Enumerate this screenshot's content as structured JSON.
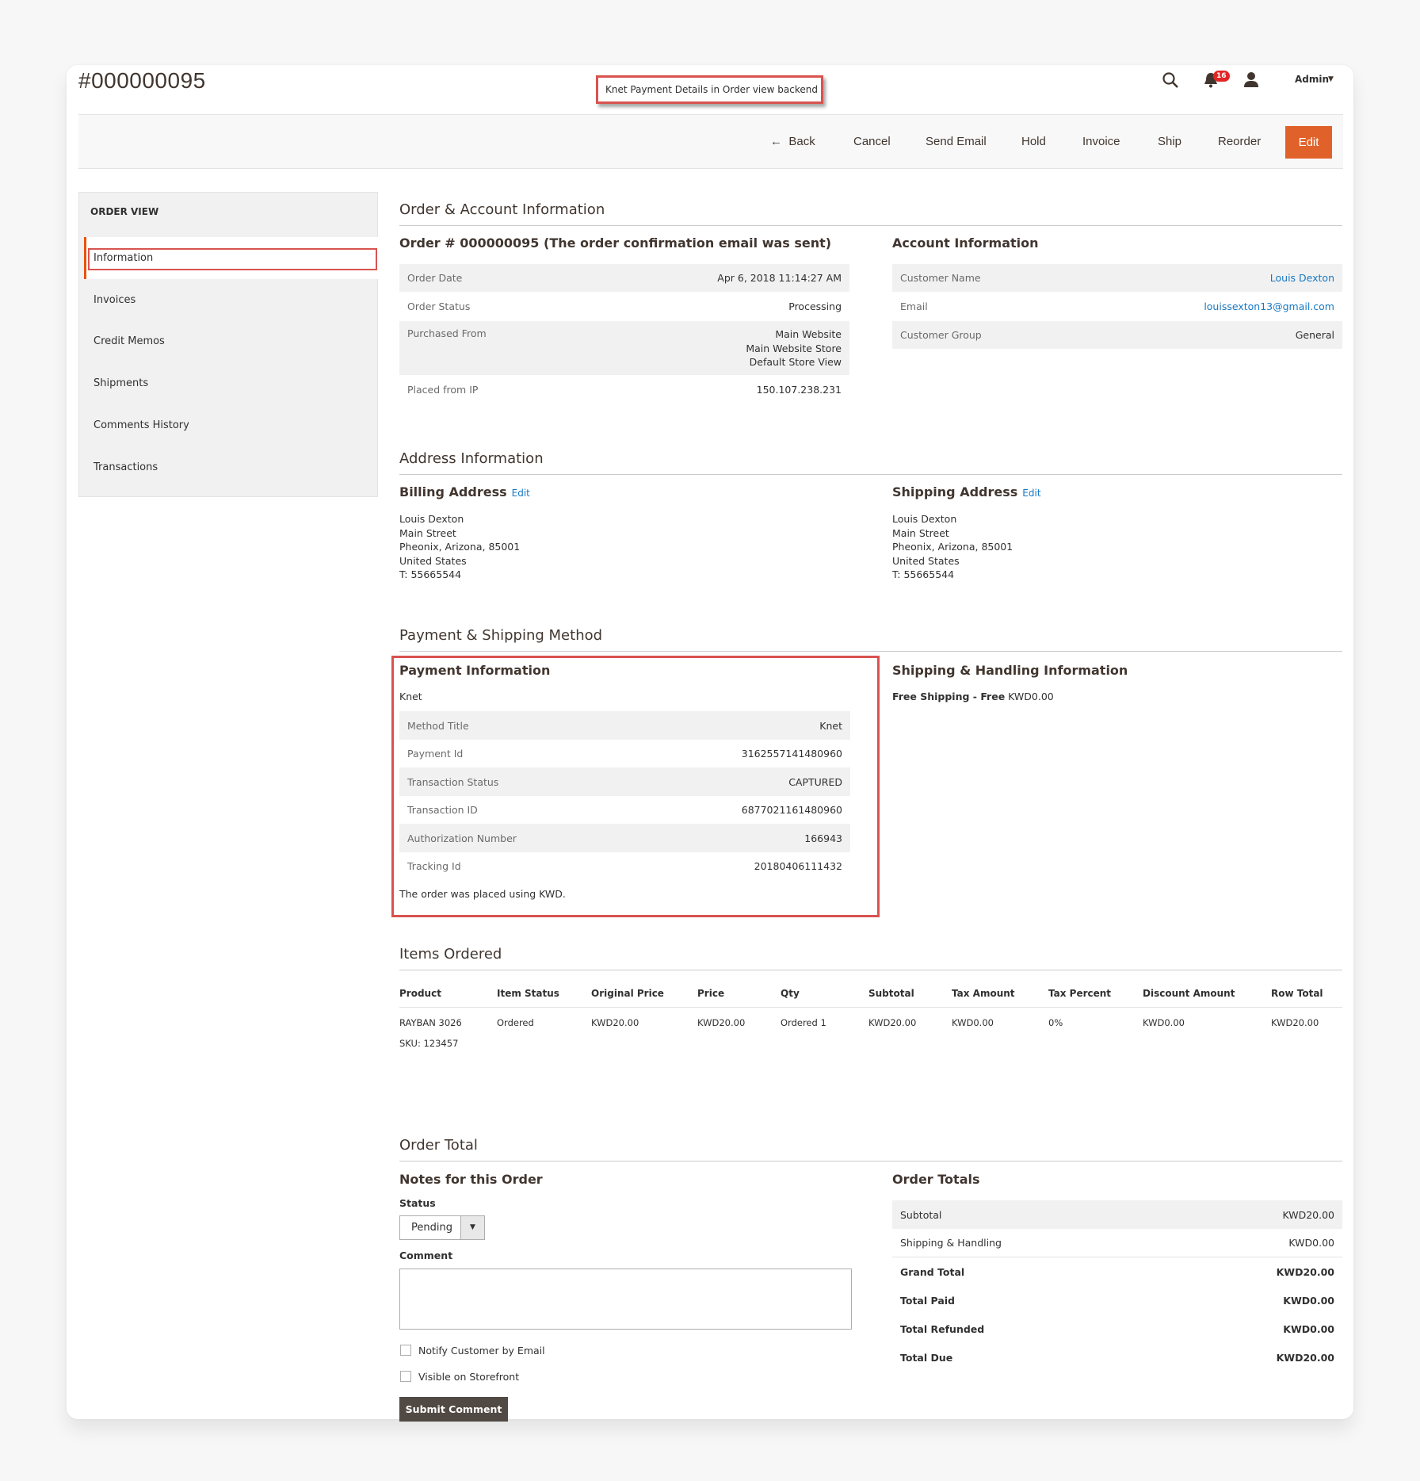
{
  "header": {
    "order_number": "#000000095",
    "annotation": "Knet Payment Details in Order view backend",
    "notification_count": "16",
    "user_label": "Admin",
    "icons": [
      "search-icon",
      "bell-icon",
      "user-icon",
      "caret-down-icon"
    ]
  },
  "toolbar": {
    "back": "Back",
    "cancel": "Cancel",
    "send_email": "Send Email",
    "hold": "Hold",
    "invoice": "Invoice",
    "ship": "Ship",
    "reorder": "Reorder",
    "edit": "Edit"
  },
  "sidebar": {
    "title": "ORDER VIEW",
    "items": [
      {
        "label": "Information",
        "active": true
      },
      {
        "label": "Invoices"
      },
      {
        "label": "Credit Memos"
      },
      {
        "label": "Shipments"
      },
      {
        "label": "Comments History"
      },
      {
        "label": "Transactions"
      }
    ]
  },
  "order_account": {
    "section_title": "Order & Account Information",
    "order_heading": "Order # 000000095 (The order confirmation email was sent)",
    "order_rows": [
      {
        "label": "Order Date",
        "value": "Apr 6, 2018 11:14:27 AM"
      },
      {
        "label": "Order Status",
        "value": "Processing"
      },
      {
        "label": "Purchased From",
        "value": [
          "Main Website",
          "Main Website Store",
          "Default Store View"
        ]
      },
      {
        "label": "Placed from IP",
        "value": "150.107.238.231"
      }
    ],
    "account_heading": "Account Information",
    "account_rows": [
      {
        "label": "Customer Name",
        "value": "Louis Dexton"
      },
      {
        "label": "Email",
        "value": "louissexton13@gmail.com"
      },
      {
        "label": "Customer Group",
        "value": "General"
      }
    ]
  },
  "address": {
    "section_title": "Address Information",
    "edit_label": "Edit",
    "billing_heading": "Billing Address",
    "shipping_heading": "Shipping Address",
    "billing_lines": [
      "Louis Dexton",
      "Main Street",
      "Pheonix, Arizona, 85001",
      "United States",
      "T: 55665544"
    ],
    "shipping_lines": [
      "Louis Dexton",
      "Main Street",
      "Pheonix, Arizona, 85001",
      "United States",
      "T: 55665544"
    ]
  },
  "payment_shipping": {
    "section_title": "Payment & Shipping Method",
    "payment_heading": "Payment Information",
    "method_name": "Knet",
    "rows": [
      {
        "label": "Method Title",
        "value": "Knet"
      },
      {
        "label": "Payment Id",
        "value": "3162557141480960"
      },
      {
        "label": "Transaction Status",
        "value": "CAPTURED"
      },
      {
        "label": "Transaction ID",
        "value": "6877021161480960"
      },
      {
        "label": "Authorization Number",
        "value": "166943"
      },
      {
        "label": "Tracking Id",
        "value": "20180406111432"
      }
    ],
    "currency_note": "The order was placed using KWD.",
    "shipping_heading": "Shipping & Handling Information",
    "shipping_method_bold": "Free Shipping - Free",
    "shipping_price": "KWD0.00"
  },
  "items": {
    "section_title": "Items Ordered",
    "columns": [
      "Product",
      "Item Status",
      "Original Price",
      "Price",
      "Qty",
      "Subtotal",
      "Tax Amount",
      "Tax Percent",
      "Discount Amount",
      "Row Total"
    ],
    "rows": [
      {
        "product": "RAYBAN 3026",
        "sku": "SKU: 123457",
        "item_status": "Ordered",
        "original_price": "KWD20.00",
        "price": "KWD20.00",
        "qty": "Ordered 1",
        "subtotal": "KWD20.00",
        "tax_amount": "KWD0.00",
        "tax_percent": "0%",
        "discount_amount": "KWD0.00",
        "row_total": "KWD20.00"
      }
    ]
  },
  "order_total": {
    "section_title": "Order Total",
    "notes_heading": "Notes for this Order",
    "status_label": "Status",
    "status_value": "Pending",
    "comment_label": "Comment",
    "comment_value": "",
    "notify_label": "Notify Customer by Email",
    "notify_checked": false,
    "visible_label": "Visible on Storefront",
    "visible_checked": false,
    "submit_label": "Submit Comment",
    "totals_heading": "Order Totals",
    "totals": [
      {
        "label": "Subtotal",
        "value": "KWD20.00"
      },
      {
        "label": "Shipping & Handling",
        "value": "KWD0.00"
      },
      {
        "label": "Grand Total",
        "value": "KWD20.00"
      },
      {
        "label": "Total Paid",
        "value": "KWD0.00"
      },
      {
        "label": "Total Refunded",
        "value": "KWD0.00"
      },
      {
        "label": "Total Due",
        "value": "KWD20.00"
      }
    ]
  },
  "colors": {
    "accent": "#eb5202",
    "edit_button": "#e0622a",
    "annotation_border": "#d9534f",
    "link": "#1979c3",
    "submit_button": "#514943",
    "badge": "#e22626"
  }
}
